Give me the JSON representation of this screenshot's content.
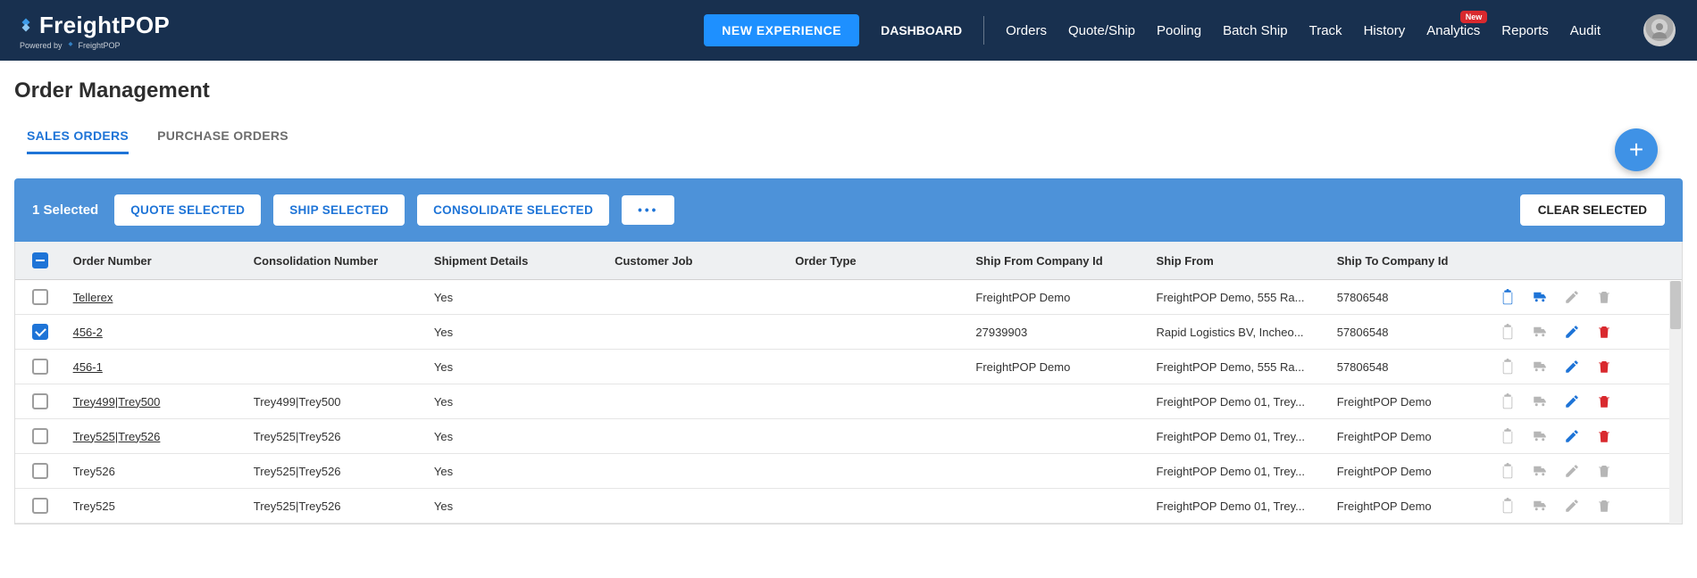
{
  "brand": {
    "name": "FreightPOP",
    "powered_by": "Powered by",
    "powered_brand": "FreightPOP"
  },
  "nav": {
    "new_experience": "NEW EXPERIENCE",
    "dashboard": "DASHBOARD",
    "items": [
      "Orders",
      "Quote/Ship",
      "Pooling",
      "Batch Ship",
      "Track",
      "History",
      "Analytics",
      "Reports",
      "Audit"
    ],
    "badge_on": "Analytics",
    "badge_text": "New"
  },
  "page": {
    "title": "Order Management",
    "tabs": {
      "sales": "SALES ORDERS",
      "purchase": "PURCHASE ORDERS"
    }
  },
  "selection": {
    "count_label": "1 Selected",
    "quote": "QUOTE SELECTED",
    "ship": "SHIP SELECTED",
    "consolidate": "CONSOLIDATE SELECTED",
    "more": "•••",
    "clear": "CLEAR SELECTED"
  },
  "columns": {
    "order_number": "Order Number",
    "consolidation": "Consolidation Number",
    "shipment_details": "Shipment Details",
    "customer_job": "Customer Job",
    "order_type": "Order Type",
    "ship_from_id": "Ship From Company Id",
    "ship_from": "Ship From",
    "ship_to_id": "Ship To Company Id"
  },
  "rows": [
    {
      "checked": false,
      "link": true,
      "order_number": "Tellerex",
      "consolidation": "",
      "shipment_details": "Yes",
      "customer_job": "",
      "order_type": "",
      "ship_from_id": "FreightPOP Demo",
      "ship_from": "FreightPOP Demo, 555 Ra...",
      "ship_to_id": "57806548",
      "icons": {
        "clipboard": "blue",
        "truck": "blue",
        "edit": "grey",
        "trash": "grey"
      }
    },
    {
      "checked": true,
      "link": true,
      "order_number": "456-2",
      "consolidation": "",
      "shipment_details": "Yes",
      "customer_job": "",
      "order_type": "",
      "ship_from_id": "27939903",
      "ship_from": "Rapid Logistics BV, Incheo...",
      "ship_to_id": "57806548",
      "icons": {
        "clipboard": "grey",
        "truck": "grey",
        "edit": "blue",
        "trash": "red"
      }
    },
    {
      "checked": false,
      "link": true,
      "order_number": "456-1",
      "consolidation": "",
      "shipment_details": "Yes",
      "customer_job": "",
      "order_type": "",
      "ship_from_id": "FreightPOP Demo",
      "ship_from": "FreightPOP Demo, 555 Ra...",
      "ship_to_id": "57806548",
      "icons": {
        "clipboard": "grey",
        "truck": "grey",
        "edit": "blue",
        "trash": "red"
      }
    },
    {
      "checked": false,
      "link": true,
      "order_number": "Trey499|Trey500",
      "consolidation": "Trey499|Trey500",
      "shipment_details": "Yes",
      "customer_job": "",
      "order_type": "",
      "ship_from_id": "",
      "ship_from": "FreightPOP Demo 01, Trey...",
      "ship_to_id": "FreightPOP Demo",
      "icons": {
        "clipboard": "grey",
        "truck": "grey",
        "edit": "blue",
        "trash": "red"
      }
    },
    {
      "checked": false,
      "link": true,
      "order_number": "Trey525|Trey526",
      "consolidation": "Trey525|Trey526",
      "shipment_details": "Yes",
      "customer_job": "",
      "order_type": "",
      "ship_from_id": "",
      "ship_from": "FreightPOP Demo 01, Trey...",
      "ship_to_id": "FreightPOP Demo",
      "icons": {
        "clipboard": "grey",
        "truck": "grey",
        "edit": "blue",
        "trash": "red"
      }
    },
    {
      "checked": false,
      "link": false,
      "order_number": "Trey526",
      "consolidation": "Trey525|Trey526",
      "shipment_details": "Yes",
      "customer_job": "",
      "order_type": "",
      "ship_from_id": "",
      "ship_from": "FreightPOP Demo 01, Trey...",
      "ship_to_id": "FreightPOP Demo",
      "icons": {
        "clipboard": "grey",
        "truck": "grey",
        "edit": "grey",
        "trash": "grey"
      }
    },
    {
      "checked": false,
      "link": false,
      "order_number": "Trey525",
      "consolidation": "Trey525|Trey526",
      "shipment_details": "Yes",
      "customer_job": "",
      "order_type": "",
      "ship_from_id": "",
      "ship_from": "FreightPOP Demo 01, Trey...",
      "ship_to_id": "FreightPOP Demo",
      "icons": {
        "clipboard": "grey",
        "truck": "grey",
        "edit": "grey",
        "trash": "grey"
      }
    }
  ]
}
